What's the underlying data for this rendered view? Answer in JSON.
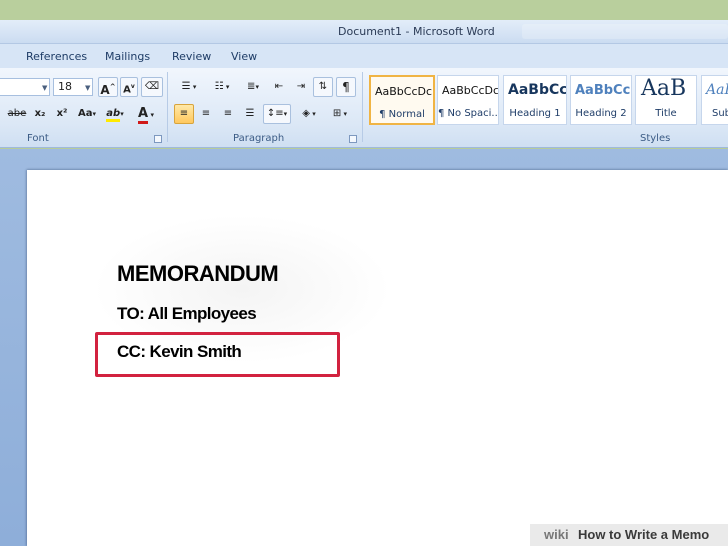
{
  "window": {
    "title": "Document1 - Microsoft Word"
  },
  "tabs": [
    "References",
    "Mailings",
    "Review",
    "View"
  ],
  "font_group": {
    "label": "Font",
    "size_value": "18",
    "grow_label": "A",
    "shrink_label": "A",
    "strike_label": "abe",
    "subscript_label": "x₂",
    "superscript_label": "x²",
    "case_label": "Aa",
    "highlight_label": "ab",
    "color_label": "A"
  },
  "paragraph_group": {
    "label": "Paragraph"
  },
  "styles_group": {
    "label": "Styles",
    "items": [
      {
        "sample": "AaBbCcDc",
        "name": "¶ Normal",
        "selected": true
      },
      {
        "sample": "AaBbCcDc",
        "name": "¶ No Spaci..."
      },
      {
        "sample": "AaBbCc",
        "name": "Heading 1"
      },
      {
        "sample": "AaBbCc",
        "name": "Heading 2"
      },
      {
        "sample": "AaB",
        "name": "Title"
      },
      {
        "sample": "AaB",
        "name": "Sub"
      }
    ]
  },
  "document": {
    "heading": "MEMORANDUM",
    "to_line": "TO: All Employees",
    "cc_line": "CC: Kevin Smith"
  },
  "watermark": {
    "brand": "wiki",
    "text": "How to Write a Memo"
  },
  "colors": {
    "highlight_border": "#d2223f",
    "selected_style_border": "#f0b444",
    "ribbon": "#dce8f6"
  }
}
